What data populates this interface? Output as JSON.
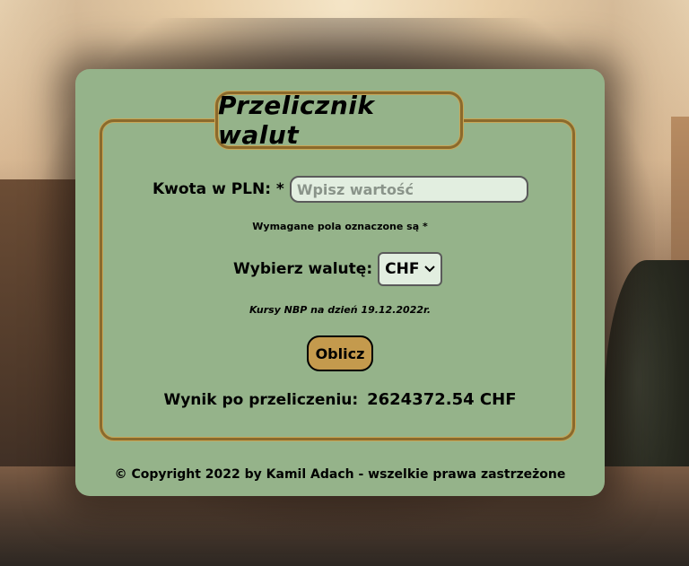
{
  "title": "Przelicznik walut",
  "amount": {
    "label": "Kwota w PLN: *",
    "placeholder": "Wpisz wartość",
    "value": ""
  },
  "required_note": "Wymagane pola oznaczone są *",
  "currency": {
    "label": "Wybierz walutę:",
    "selected": "CHF"
  },
  "rates_note": "Kursy NBP na dzień 19.12.2022r.",
  "calculate_button": "Oblicz",
  "result": {
    "label": "Wynik po przeliczeniu:",
    "value": "2624372.54 CHF"
  },
  "footer": "© Copyright 2022 by Kamil Adach - wszelkie prawa zastrzeżone",
  "colors": {
    "card_background": "#95b38a",
    "border_gold": "#8b6a2c",
    "button_background": "#c49a4d",
    "input_background": "#e2eee0"
  }
}
